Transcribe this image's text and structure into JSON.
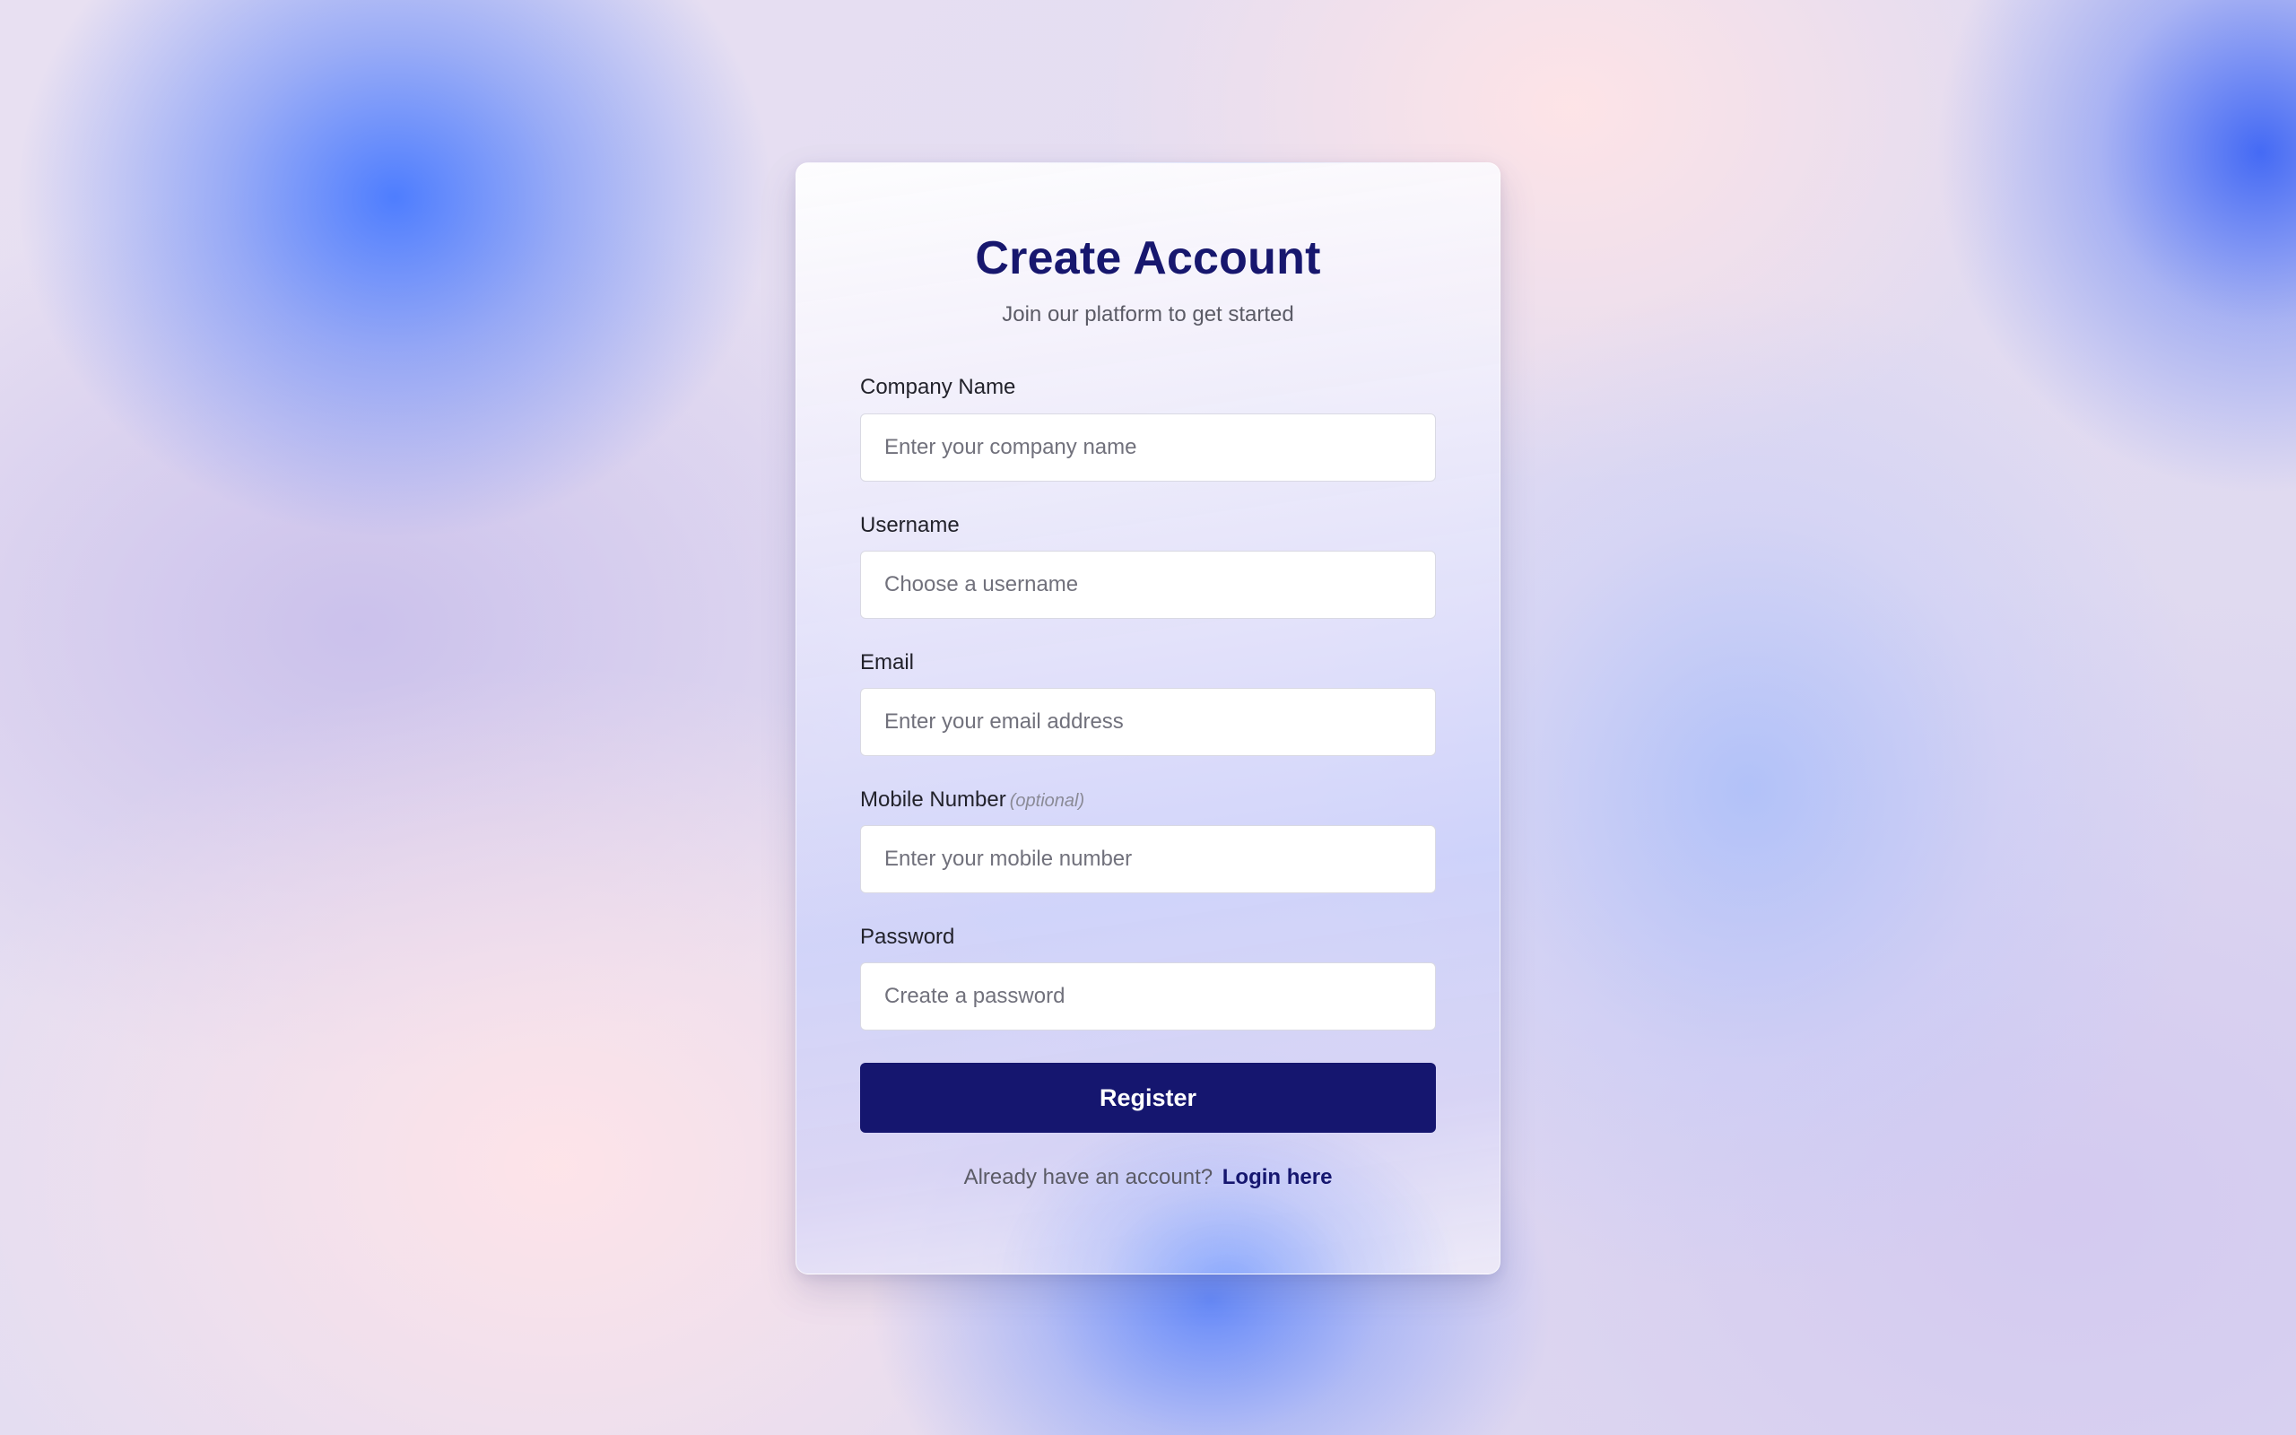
{
  "colors": {
    "primary": "#15166f",
    "title": "#17176e",
    "muted_text": "#5b5b66",
    "input_border": "#d9d9e3"
  },
  "header": {
    "title": "Create Account",
    "subtitle": "Join our platform to get started"
  },
  "form": {
    "fields": [
      {
        "label": "Company Name",
        "placeholder": "Enter your company name",
        "value": ""
      },
      {
        "label": "Username",
        "placeholder": "Choose a username",
        "value": ""
      },
      {
        "label": "Email",
        "placeholder": "Enter your email address",
        "value": ""
      },
      {
        "label": "Mobile Number",
        "optional_tag": "(optional)",
        "placeholder": "Enter your mobile number",
        "value": ""
      },
      {
        "label": "Password",
        "placeholder": "Create a password",
        "value": ""
      }
    ],
    "submit_label": "Register"
  },
  "footer": {
    "prompt": "Already have an account?",
    "link_label": "Login here"
  }
}
